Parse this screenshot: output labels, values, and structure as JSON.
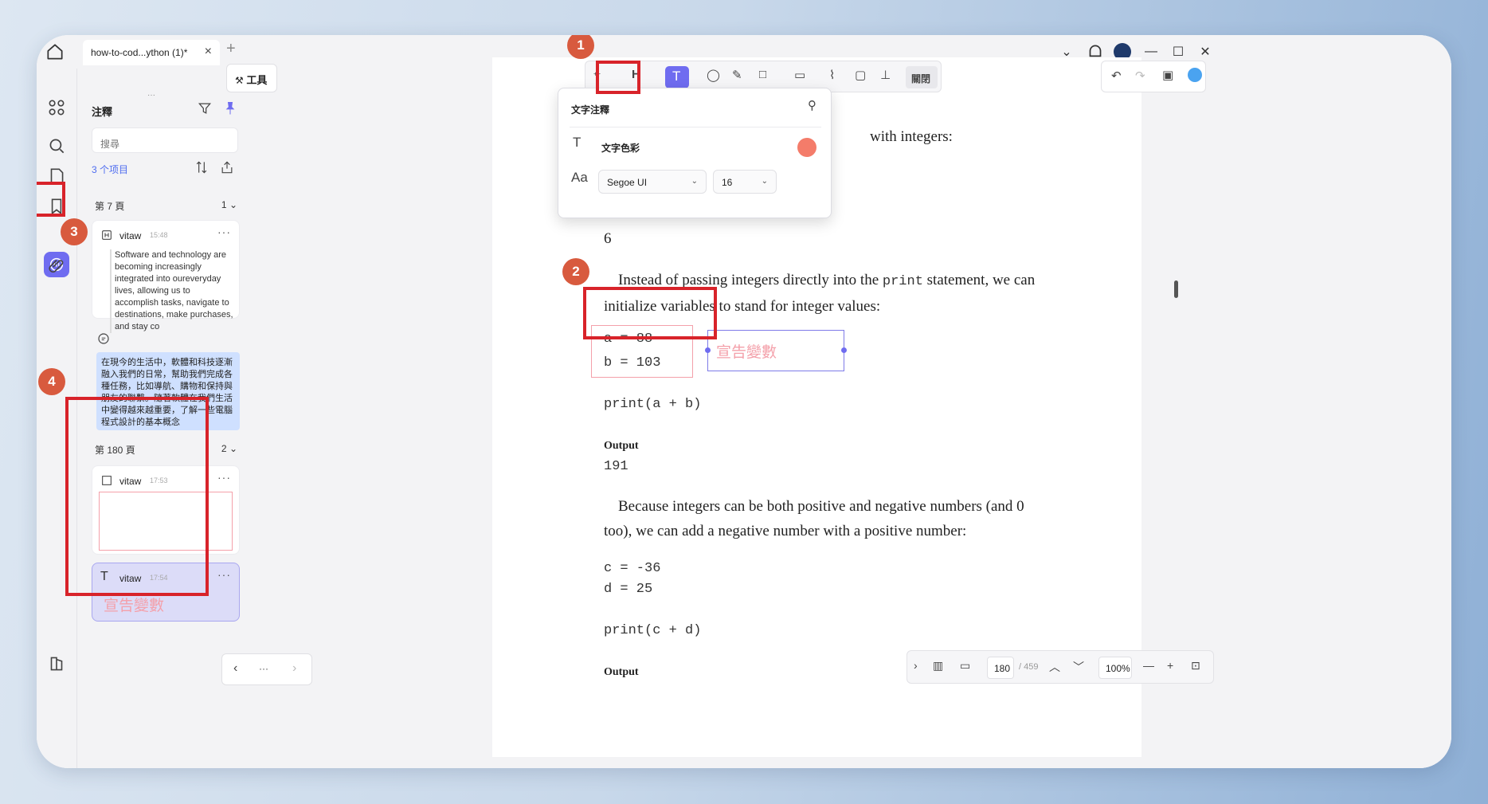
{
  "titlebar": {
    "tab_title": "how-to-cod...ython (1)*"
  },
  "panel": {
    "title": "注釋",
    "search_placeholder": "搜尋",
    "item_count": "3 个项目",
    "groups": [
      {
        "label": "第 7 頁",
        "count": "1"
      },
      {
        "label": "第 180 頁",
        "count": "2"
      }
    ],
    "cards": [
      {
        "user": "vitaw",
        "time": "15:48",
        "text": "Software and technology are becoming increasingly integrated into oureveryday lives, allowing us to accomplish tasks, navigate to destinations, make purchases, and stay co"
      },
      {
        "user": "vitaw",
        "time": "17:53"
      },
      {
        "user": "vitaw",
        "time": "17:54",
        "text": "宣告變數"
      }
    ],
    "comment": "在現今的生活中，軟體和科技逐漸融入我們的日常，幫助我們完成各種任務，比如導航、購物和保持與朋友的聯繫。隨著軟體在我們生活中變得越來越重要，了解一些電腦程式設計的基本概念"
  },
  "workspace": {
    "tools_label": "工具",
    "nav_dots": "···"
  },
  "toolbar": {
    "close_label": "關閉"
  },
  "popup": {
    "title": "文字注釋",
    "color_label": "文字色彩",
    "font_name": "Segoe UI",
    "font_size": "16",
    "text_color": "#f47c6a"
  },
  "document": {
    "line_with_integers": "with integers:",
    "line_six": "6",
    "para1_a": "Instead of passing integers directly into the ",
    "para1_code": "print",
    "para1_b": " statement, we can",
    "para1_c": "initialize variables to stand for integer values:",
    "code_a": "a = 88",
    "code_b": "b = 103",
    "textbox": "宣告變數",
    "code_print1": "print(a + b)",
    "output1_label": "Output",
    "output1_value": "191",
    "para2_a": "Because integers can be both positive and negative numbers (and 0",
    "para2_b": "too), we can add a negative number with a positive number:",
    "code_c": "c = -36",
    "code_d": "d = 25",
    "code_print2": "print(c + d)",
    "output2_label": "Output"
  },
  "statusbar": {
    "page_current": "180",
    "page_total": "/ 459",
    "zoom": "100%"
  },
  "callouts": [
    "1",
    "2",
    "3",
    "4"
  ]
}
